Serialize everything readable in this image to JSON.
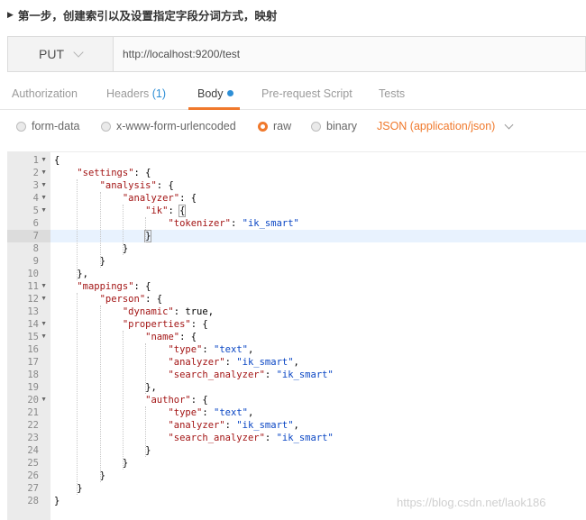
{
  "heading": {
    "text": "第一步，创建索引以及设置指定字段分词方式，映射"
  },
  "request": {
    "method": "PUT",
    "url": "http://localhost:9200/test"
  },
  "tabs": {
    "authorization": "Authorization",
    "headers": "Headers",
    "headers_count": "(1)",
    "body": "Body",
    "pre_request": "Pre-request Script",
    "tests": "Tests"
  },
  "body_options": {
    "form_data": "form-data",
    "urlencoded": "x-www-form-urlencoded",
    "raw": "raw",
    "binary": "binary",
    "selected": "raw",
    "content_type": "JSON (application/json)"
  },
  "editor": {
    "current_line": 7,
    "lines": [
      {
        "n": "1",
        "fold": true,
        "segs": [
          {
            "t": "{",
            "c": "v"
          }
        ]
      },
      {
        "n": "2",
        "fold": true,
        "segs": [
          {
            "t": "    ",
            "c": "v"
          },
          {
            "t": "\"settings\"",
            "c": "k"
          },
          {
            "t": ": {",
            "c": "v"
          }
        ]
      },
      {
        "n": "3",
        "fold": true,
        "segs": [
          {
            "t": "        ",
            "c": "v"
          },
          {
            "t": "\"analysis\"",
            "c": "k"
          },
          {
            "t": ": {",
            "c": "v"
          }
        ]
      },
      {
        "n": "4",
        "fold": true,
        "segs": [
          {
            "t": "            ",
            "c": "v"
          },
          {
            "t": "\"analyzer\"",
            "c": "k"
          },
          {
            "t": ": {",
            "c": "v"
          }
        ]
      },
      {
        "n": "5",
        "fold": true,
        "segs": [
          {
            "t": "                ",
            "c": "v"
          },
          {
            "t": "\"ik\"",
            "c": "k"
          },
          {
            "t": ": ",
            "c": "v"
          },
          {
            "t": "{",
            "c": "v hl"
          }
        ]
      },
      {
        "n": "6",
        "fold": false,
        "segs": [
          {
            "t": "                    ",
            "c": "v"
          },
          {
            "t": "\"tokenizer\"",
            "c": "k"
          },
          {
            "t": ": ",
            "c": "v"
          },
          {
            "t": "\"ik_smart\"",
            "c": "s"
          }
        ]
      },
      {
        "n": "7",
        "fold": false,
        "segs": [
          {
            "t": "                ",
            "c": "v"
          },
          {
            "t": "}",
            "c": "v hl"
          },
          {
            "t": "",
            "c": "cursor"
          }
        ]
      },
      {
        "n": "8",
        "fold": false,
        "segs": [
          {
            "t": "            }",
            "c": "v"
          }
        ]
      },
      {
        "n": "9",
        "fold": false,
        "segs": [
          {
            "t": "        }",
            "c": "v"
          }
        ]
      },
      {
        "n": "10",
        "fold": false,
        "segs": [
          {
            "t": "    },",
            "c": "v"
          }
        ]
      },
      {
        "n": "11",
        "fold": true,
        "segs": [
          {
            "t": "    ",
            "c": "v"
          },
          {
            "t": "\"mappings\"",
            "c": "k"
          },
          {
            "t": ": {",
            "c": "v"
          }
        ]
      },
      {
        "n": "12",
        "fold": true,
        "segs": [
          {
            "t": "        ",
            "c": "v"
          },
          {
            "t": "\"person\"",
            "c": "k"
          },
          {
            "t": ": {",
            "c": "v"
          }
        ]
      },
      {
        "n": "13",
        "fold": false,
        "segs": [
          {
            "t": "            ",
            "c": "v"
          },
          {
            "t": "\"dynamic\"",
            "c": "k"
          },
          {
            "t": ": true,",
            "c": "v"
          }
        ]
      },
      {
        "n": "14",
        "fold": true,
        "segs": [
          {
            "t": "            ",
            "c": "v"
          },
          {
            "t": "\"properties\"",
            "c": "k"
          },
          {
            "t": ": {",
            "c": "v"
          }
        ]
      },
      {
        "n": "15",
        "fold": true,
        "segs": [
          {
            "t": "                ",
            "c": "v"
          },
          {
            "t": "\"name\"",
            "c": "k"
          },
          {
            "t": ": {",
            "c": "v"
          }
        ]
      },
      {
        "n": "16",
        "fold": false,
        "segs": [
          {
            "t": "                    ",
            "c": "v"
          },
          {
            "t": "\"type\"",
            "c": "k"
          },
          {
            "t": ": ",
            "c": "v"
          },
          {
            "t": "\"text\"",
            "c": "s"
          },
          {
            "t": ",",
            "c": "v"
          }
        ]
      },
      {
        "n": "17",
        "fold": false,
        "segs": [
          {
            "t": "                    ",
            "c": "v"
          },
          {
            "t": "\"analyzer\"",
            "c": "k"
          },
          {
            "t": ": ",
            "c": "v"
          },
          {
            "t": "\"ik_smart\"",
            "c": "s"
          },
          {
            "t": ",",
            "c": "v"
          }
        ]
      },
      {
        "n": "18",
        "fold": false,
        "segs": [
          {
            "t": "                    ",
            "c": "v"
          },
          {
            "t": "\"search_analyzer\"",
            "c": "k"
          },
          {
            "t": ": ",
            "c": "v"
          },
          {
            "t": "\"ik_smart\"",
            "c": "s"
          }
        ]
      },
      {
        "n": "19",
        "fold": false,
        "segs": [
          {
            "t": "                },",
            "c": "v"
          }
        ]
      },
      {
        "n": "20",
        "fold": true,
        "segs": [
          {
            "t": "                ",
            "c": "v"
          },
          {
            "t": "\"author\"",
            "c": "k"
          },
          {
            "t": ": {",
            "c": "v"
          }
        ]
      },
      {
        "n": "21",
        "fold": false,
        "segs": [
          {
            "t": "                    ",
            "c": "v"
          },
          {
            "t": "\"type\"",
            "c": "k"
          },
          {
            "t": ": ",
            "c": "v"
          },
          {
            "t": "\"text\"",
            "c": "s"
          },
          {
            "t": ",",
            "c": "v"
          }
        ]
      },
      {
        "n": "22",
        "fold": false,
        "segs": [
          {
            "t": "                    ",
            "c": "v"
          },
          {
            "t": "\"analyzer\"",
            "c": "k"
          },
          {
            "t": ": ",
            "c": "v"
          },
          {
            "t": "\"ik_smart\"",
            "c": "s"
          },
          {
            "t": ",",
            "c": "v"
          }
        ]
      },
      {
        "n": "23",
        "fold": false,
        "segs": [
          {
            "t": "                    ",
            "c": "v"
          },
          {
            "t": "\"search_analyzer\"",
            "c": "k"
          },
          {
            "t": ": ",
            "c": "v"
          },
          {
            "t": "\"ik_smart\"",
            "c": "s"
          }
        ]
      },
      {
        "n": "24",
        "fold": false,
        "segs": [
          {
            "t": "                }",
            "c": "v"
          }
        ]
      },
      {
        "n": "25",
        "fold": false,
        "segs": [
          {
            "t": "            }",
            "c": "v"
          }
        ]
      },
      {
        "n": "26",
        "fold": false,
        "segs": [
          {
            "t": "        }",
            "c": "v"
          }
        ]
      },
      {
        "n": "27",
        "fold": false,
        "segs": [
          {
            "t": "    }",
            "c": "v"
          }
        ]
      },
      {
        "n": "28",
        "fold": false,
        "segs": [
          {
            "t": "}",
            "c": "v"
          }
        ]
      }
    ]
  },
  "colors": {
    "accent": "#f0792c",
    "link_blue": "#2e8fd6",
    "json_key": "#a31515",
    "json_string": "#0a46c4"
  },
  "watermark": "https://blog.csdn.net/laok186"
}
